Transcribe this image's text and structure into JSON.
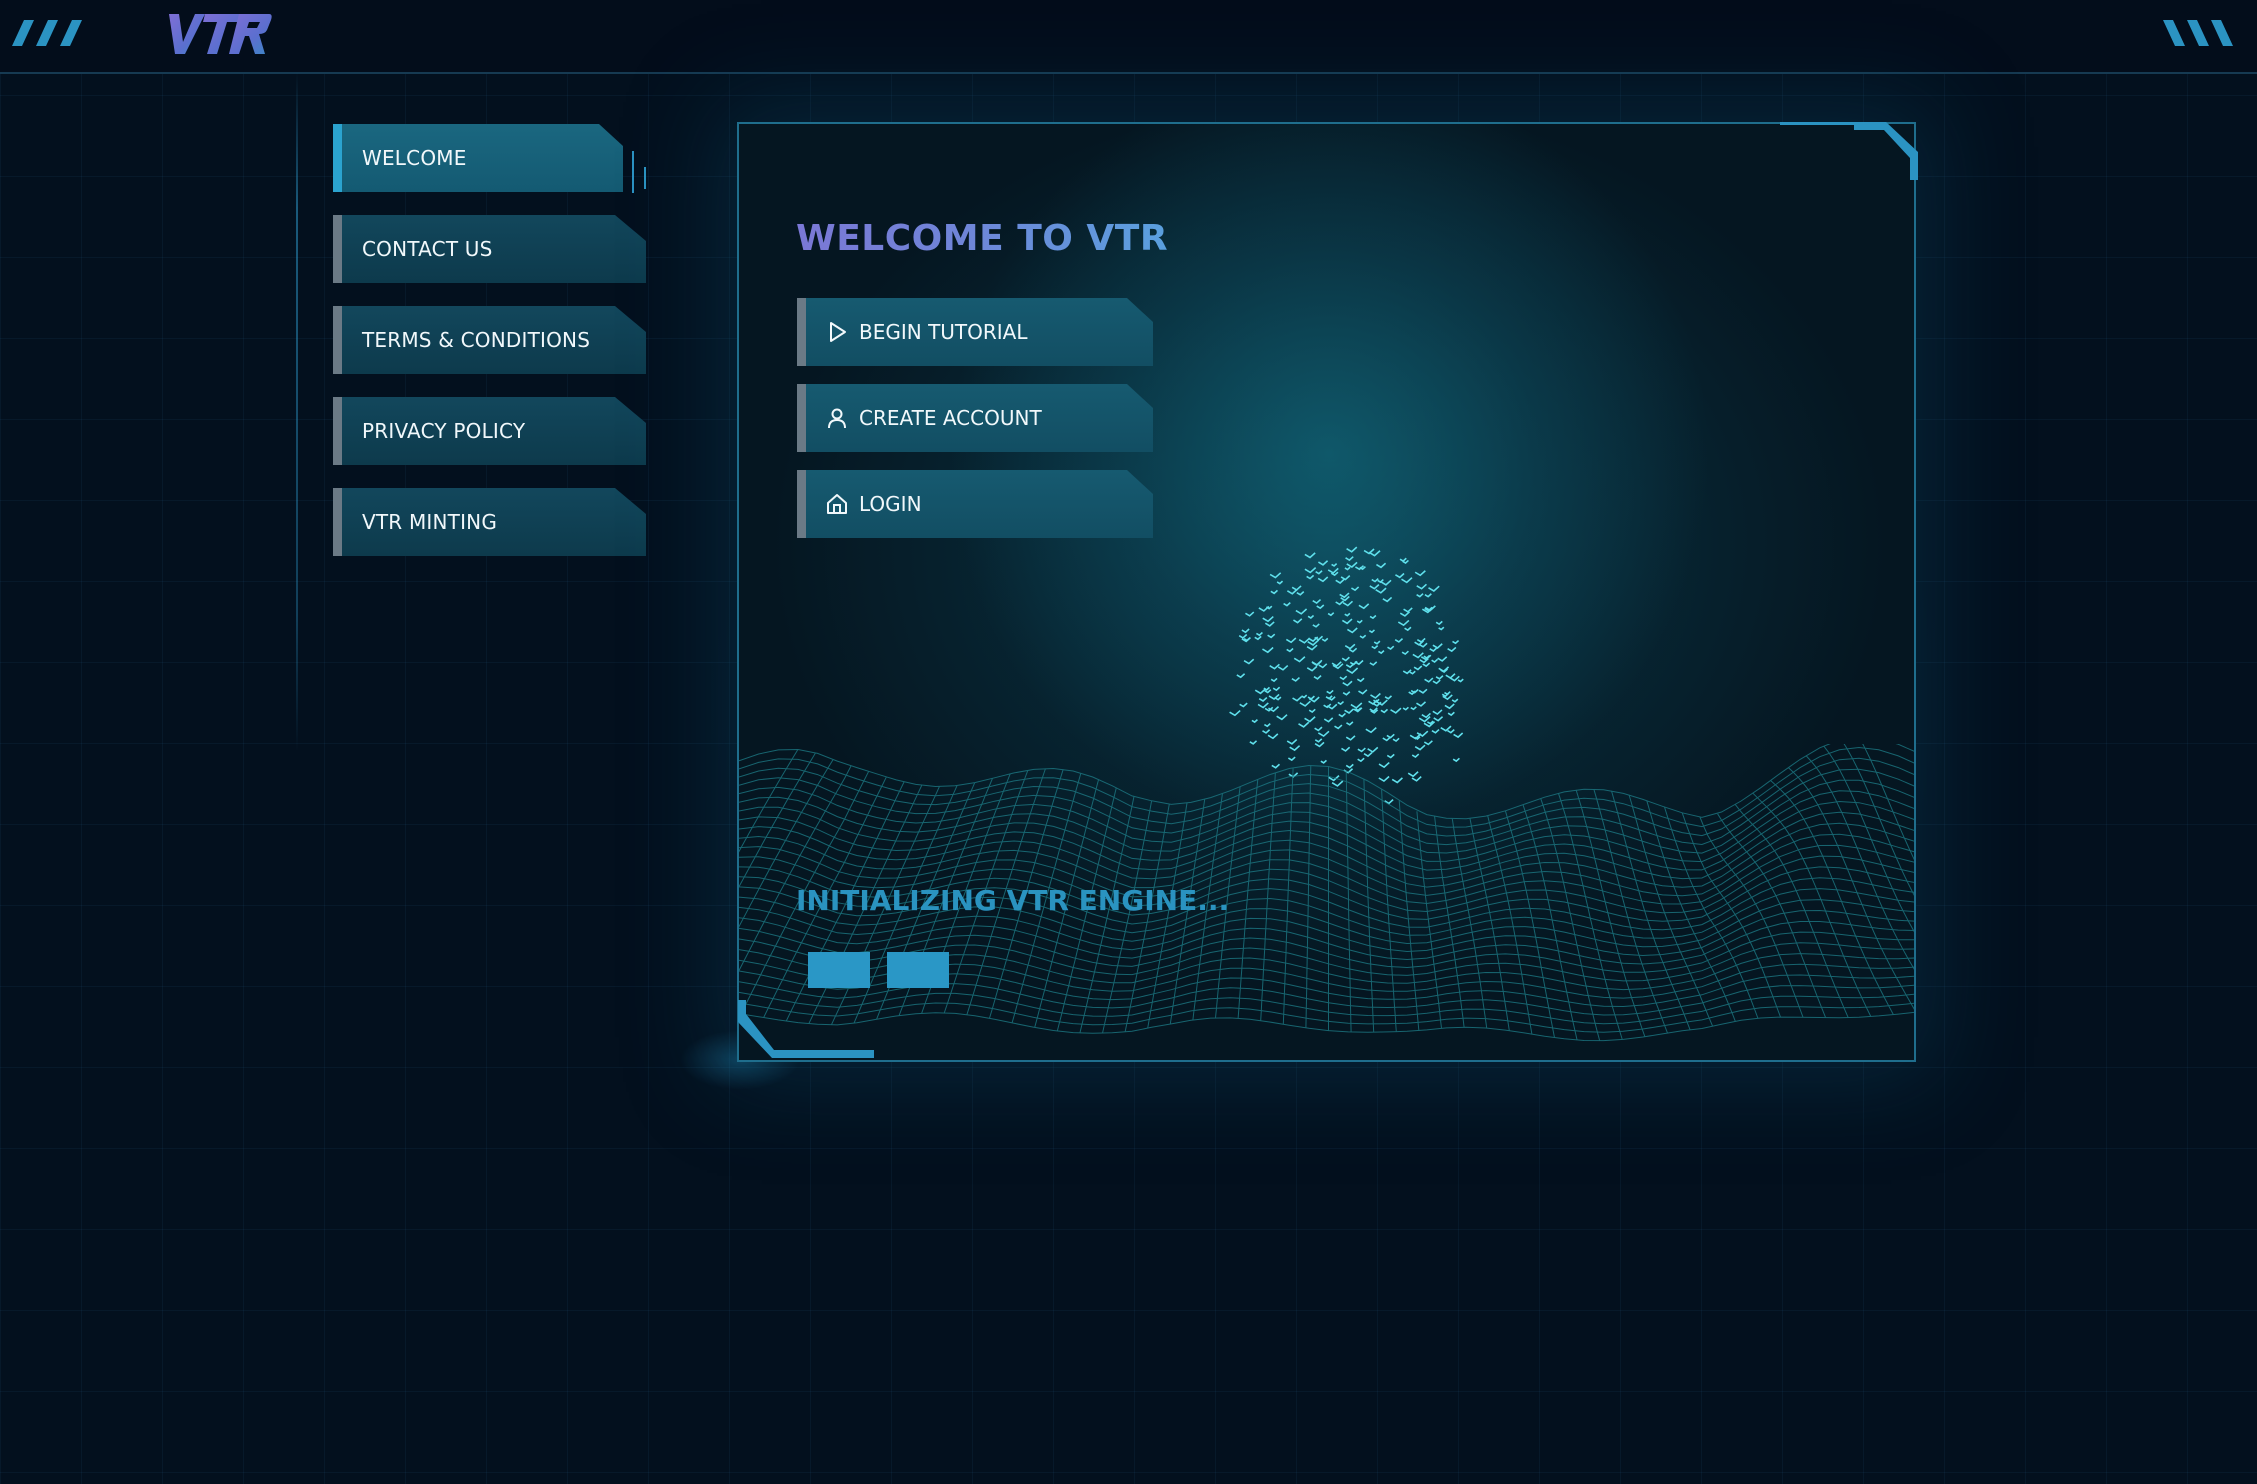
{
  "app": {
    "logo_text": "VTR"
  },
  "sidebar": {
    "items": [
      {
        "label": "WELCOME",
        "active": true
      },
      {
        "label": "CONTACT US",
        "active": false
      },
      {
        "label": "TERMS & CONDITIONS",
        "active": false
      },
      {
        "label": "PRIVACY POLICY",
        "active": false
      },
      {
        "label": "VTR MINTING",
        "active": false
      }
    ]
  },
  "main": {
    "title": "WELCOME TO VTR",
    "actions": [
      {
        "label": "BEGIN TUTORIAL",
        "icon": "play-icon"
      },
      {
        "label": "CREATE ACCOUNT",
        "icon": "user-icon"
      },
      {
        "label": "LOGIN",
        "icon": "home-icon"
      }
    ],
    "status_text": "INITIALIZING VTR ENGINE...",
    "loader_blocks": 2
  },
  "colors": {
    "background": "#03101e",
    "accent": "#2a97c6",
    "title_gradient_start": "#7b78d6",
    "title_gradient_end": "#5aa0de",
    "button_fill": "#165a70",
    "active_nav_edge": "#2ba3cf",
    "inactive_edge": "#6b7a86"
  }
}
